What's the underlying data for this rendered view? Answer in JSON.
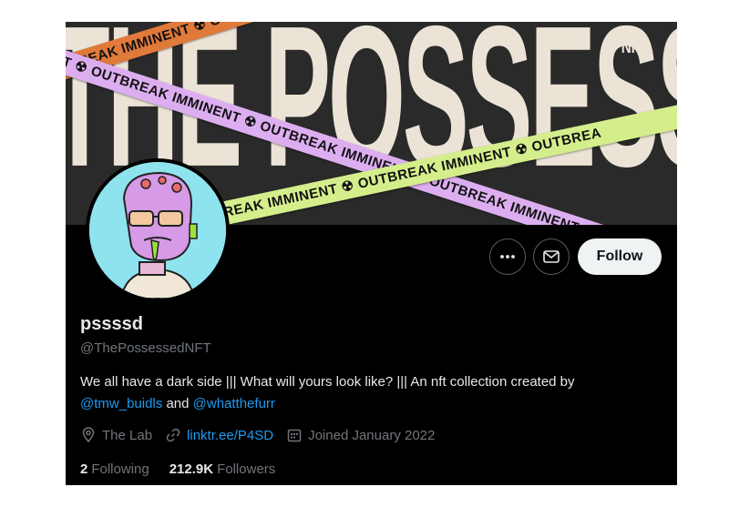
{
  "banner": {
    "title": "THE POSSESSED",
    "tag": "NFT",
    "tape_orange": "UTBREAK IMMINENT ☢ OUTBREAK IMMINENT ☢ OUTBREAK IMMINENT",
    "tape_lilac": "NT ☢ OUTBREAK IMMINENT ☢ OUTBREAK IMMINENT ☢ OUTBREAK IMMINENT ☢ OUTBREAK IMMINEN",
    "tape_green": "BREAK IMMINENT ☢ OUTBREAK IMMINENT ☢ OUTBREA",
    "colors": {
      "background": "#2a2a2a",
      "title": "#ebe3d6",
      "orange": "#e07a3b",
      "lilac": "#dcaef0",
      "green": "#d5ee8c"
    }
  },
  "actions": {
    "more_icon": "more-horizontal-icon",
    "message_icon": "envelope-icon",
    "follow_label": "Follow"
  },
  "profile": {
    "display_name": "pssssd",
    "handle": "@ThePossessedNFT",
    "bio_text": "We all have a dark side ||| What will yours look like? ||| An nft collection created by",
    "bio_mention_1": "@tmw_buidls",
    "bio_and": "and",
    "bio_mention_2": "@whatthefurr"
  },
  "meta": {
    "location": "The Lab",
    "website": "linktr.ee/P4SD",
    "joined": "Joined January 2022"
  },
  "stats": {
    "following_count": "2",
    "following_label": "Following",
    "followers_count": "212.9K",
    "followers_label": "Followers"
  },
  "colors": {
    "link": "#1d9bf0",
    "text": "#e7e9ea",
    "muted": "#71767b",
    "bg": "#000000"
  }
}
